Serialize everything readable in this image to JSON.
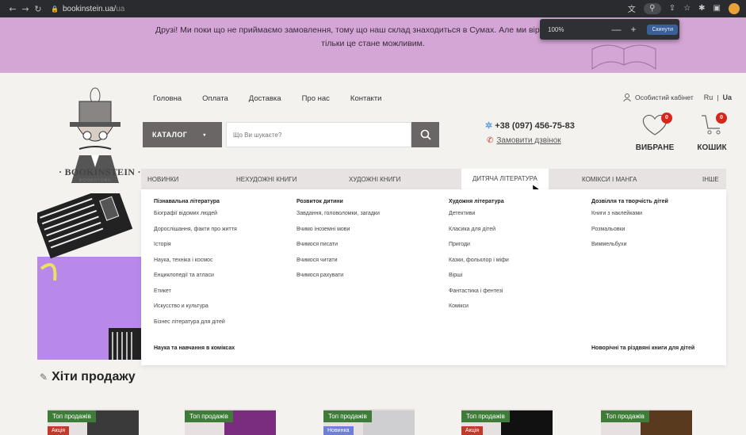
{
  "browser": {
    "url_domain": "bookinstein.ua/",
    "url_path": "ua",
    "zoom_percent": "100%",
    "zoom_minus": "—",
    "zoom_plus": "+",
    "zoom_reset": "Скинути"
  },
  "promo": {
    "line1": "Друзі! Ми поки що не приймаємо замовлення, тому що наш склад знаходиться в Сумах. Але ми віримо в нашу п",
    "line2": "тільки це стане можливим."
  },
  "logo": {
    "name": "· BOOKINSTEIN ·",
    "sub": "BOOKSTORE"
  },
  "topnav": [
    "Головна",
    "Оплата",
    "Доставка",
    "Про нас",
    "Контакти"
  ],
  "account": {
    "label": "Особистий кабінет",
    "lang_ru": "Ru",
    "sep": "|",
    "lang_ua": "Ua"
  },
  "catalog": {
    "label": "КАТАЛОГ",
    "arrow": "▾"
  },
  "search": {
    "placeholder": "Що Ви шукаєте?"
  },
  "contact": {
    "phone": "+38 (097) 456-75-83",
    "callback": "Замовити дзвінок"
  },
  "favorites": {
    "label": "ВИБРАНЕ",
    "count": "0"
  },
  "cart": {
    "label": "КОШИК",
    "count": "0"
  },
  "categories": [
    "НОВИНКИ",
    "НЕХУДОЖНІ КНИГИ",
    "ХУДОЖНІ КНИГИ",
    "ДИТЯЧА ЛІТЕРАТУРА",
    "КОМІКСИ І МАНГА",
    "ІНШЕ"
  ],
  "mega": {
    "columns": [
      {
        "title": "Пізнавальна література",
        "items": [
          "Біографії відомих людей",
          "Дорослішання, факти про життя",
          "Історія",
          "Наука, техніка і космос",
          "Енциклопедії та атласи",
          "Етикет",
          "Искусство и культура",
          "Бізнес література для дітей"
        ]
      },
      {
        "title": "Розвиток дитини",
        "items": [
          "Завдання, головоломки, загадки",
          "Вчимо іноземні мови",
          "Вчимося писати",
          "Вчимося читати",
          "Вчимося рахувати"
        ]
      },
      {
        "title": "Художня література",
        "items": [
          "Детективи",
          "Класика для дітей",
          "Пригоди",
          "Казки, фольклор і міфи",
          "Вірші",
          "Фантастика і фентезі",
          "Комікси"
        ]
      },
      {
        "title": "Дозвілля та творчість дітей",
        "items": [
          "Книги з наклейками",
          "Розмальовки",
          "Виммельбухи"
        ]
      }
    ],
    "footer_left": "Наука та навчання в коміксах",
    "footer_right": "Новорічні та різдвяні книги для дітей"
  },
  "bestsellers": {
    "title": "Хіти продажу",
    "products": [
      {
        "tag": "Топ продажів",
        "extra": "Акція"
      },
      {
        "tag": "Топ продажів",
        "extra": ""
      },
      {
        "tag": "Топ продажів",
        "extra": "Новинка"
      },
      {
        "tag": "Топ продажів",
        "extra": "Акція"
      },
      {
        "tag": "Топ продажів",
        "extra": ""
      }
    ]
  }
}
